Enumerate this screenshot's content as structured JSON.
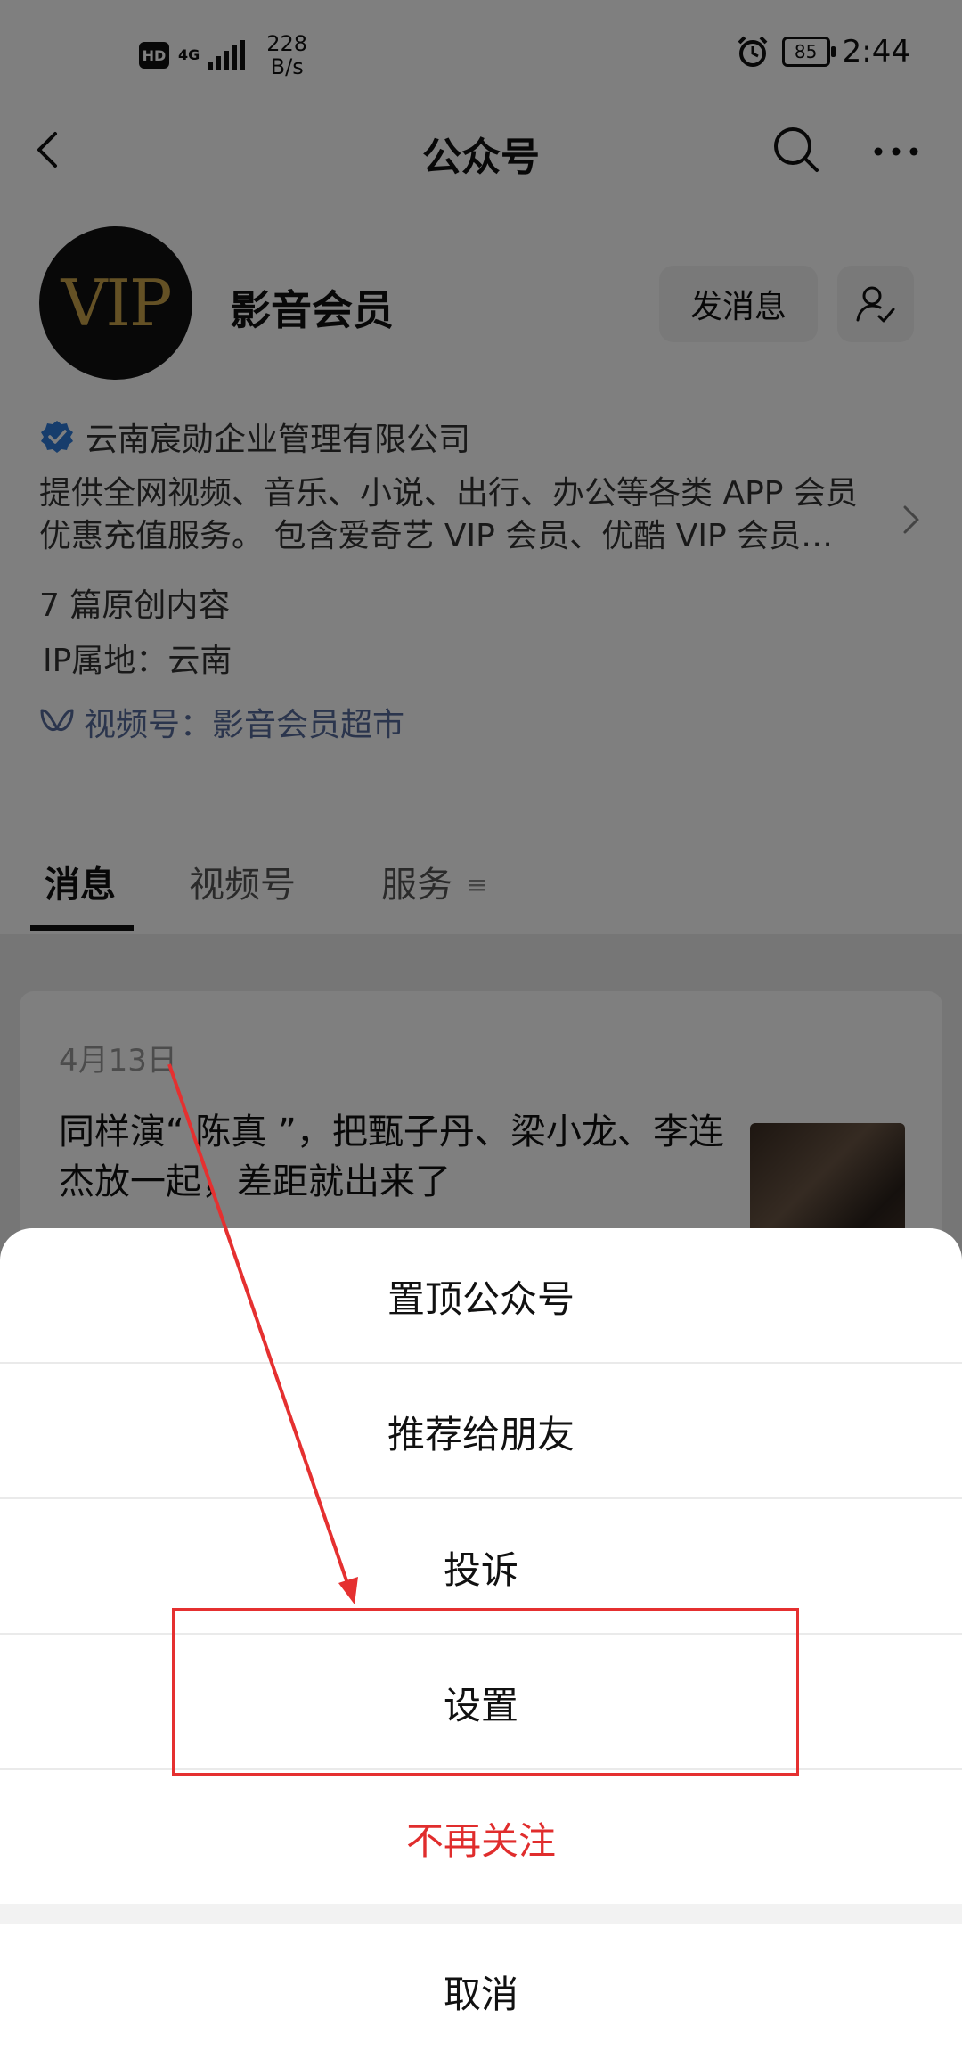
{
  "status_bar": {
    "hd_badge": "HD",
    "network_type": "4G",
    "speed_value": "228",
    "speed_unit": "B/s",
    "battery": "85",
    "time": "2:44"
  },
  "header": {
    "title": "公众号"
  },
  "profile": {
    "avatar_text": "VIP",
    "name": "影音会员",
    "message_button": "发消息",
    "company": "云南宸勋企业管理有限公司",
    "description_line1": "提供全网视频、音乐、小说、出行、办公等各类 APP 会员",
    "description_line2": "优惠充值服务。 包含爱奇艺 VIP 会员、优酷 VIP 会员…",
    "original_count": "7 篇原创内容",
    "ip_location": "IP属地：云南",
    "channel": "视频号：影音会员超市"
  },
  "tabs": [
    {
      "label": "消息"
    },
    {
      "label": "视频号"
    },
    {
      "label": "服务"
    }
  ],
  "article": {
    "date": "4月13日",
    "title": "同样演“ 陈真 ”，把甄子丹、梁小龙、李连杰放一起，差距就出来了"
  },
  "action_sheet": {
    "pin": "置顶公众号",
    "recommend": "推荐给朋友",
    "report": "投诉",
    "settings": "设置",
    "unfollow": "不再关注",
    "cancel": "取消"
  },
  "colors": {
    "danger": "#e02d2d",
    "annotation": "#e53030",
    "link": "#566b9a"
  }
}
